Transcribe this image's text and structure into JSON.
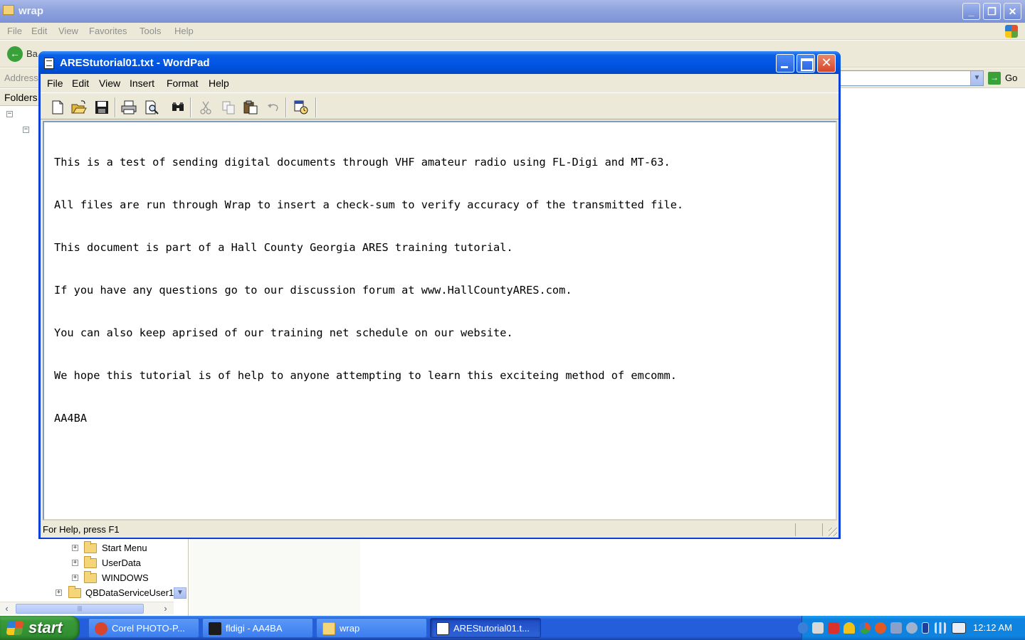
{
  "explorer": {
    "title": "wrap",
    "menu": [
      "File",
      "Edit",
      "View",
      "Favorites",
      "Tools",
      "Help"
    ],
    "back_label": "Ba",
    "address_label": "Address",
    "go_label": "Go",
    "folders_label": "Folders",
    "tree_items": [
      "Start Menu",
      "UserData",
      "WINDOWS",
      "QBDataServiceUser1"
    ]
  },
  "wordpad": {
    "title": "AREStutorial01.txt - WordPad",
    "menu": [
      "File",
      "Edit",
      "View",
      "Insert",
      "Format",
      "Help"
    ],
    "toolbar_icons": [
      "new-document-icon",
      "open-folder-icon",
      "save-disk-icon",
      "print-icon",
      "print-preview-icon",
      "find-binoculars-icon",
      "cut-scissors-icon",
      "copy-icon",
      "paste-icon",
      "undo-icon",
      "date-time-icon"
    ],
    "document_lines": [
      "This is a test of sending digital documents through VHF amateur radio using FL-Digi and MT-63.",
      "All files are run through Wrap to insert a check-sum to verify accuracy of the transmitted file.",
      "This document is part of a Hall County Georgia ARES training tutorial.",
      "If you have any questions go to our discussion forum at www.HallCountyARES.com.",
      "You can also keep aprised of our training net schedule on our website.",
      "We hope this tutorial is of help to anyone attempting to learn this exciteing method of emcomm.",
      "AA4BA"
    ],
    "status_text": "For Help, press F1"
  },
  "taskbar": {
    "start_label": "start",
    "tasks": [
      {
        "label": "Corel PHOTO-P...",
        "icon": "corel-icon",
        "color": "#d9442c",
        "active": false
      },
      {
        "label": "fldigi - AA4BA",
        "icon": "fldigi-icon",
        "color": "#1c1c1c",
        "active": false
      },
      {
        "label": "wrap",
        "icon": "folder-icon",
        "color": "#f5d57a",
        "active": false
      },
      {
        "label": "AREStutorial01.t...",
        "icon": "wordpad-icon",
        "color": "#ffffff",
        "active": true
      }
    ],
    "clock": "12:12 AM"
  },
  "colors": {
    "xp_title_blue": "#0054e3",
    "taskbar_blue": "#245edb",
    "start_green": "#3a9a3a",
    "window_face": "#ece9d8"
  }
}
